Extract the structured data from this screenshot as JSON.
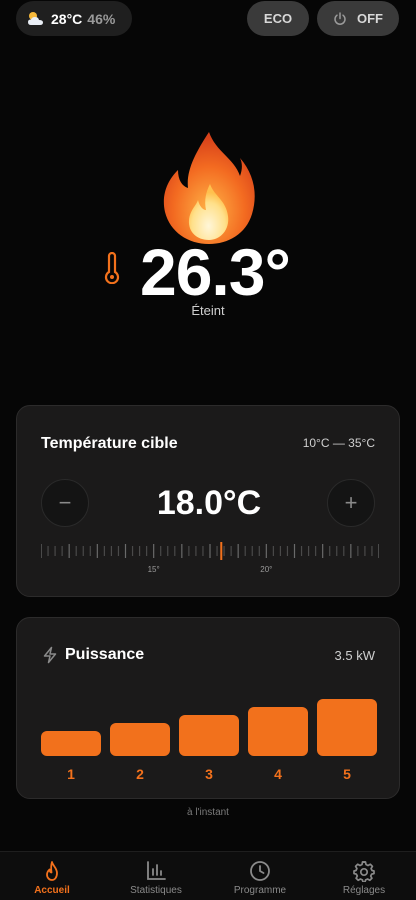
{
  "weather": {
    "temp": "28°C",
    "humidity": "46%",
    "icon": "partly-cloudy-icon"
  },
  "header": {
    "eco_label": "ECO",
    "power_label": "OFF"
  },
  "hero": {
    "current_temp": "26.3°",
    "status": "Éteint"
  },
  "target": {
    "title": "Température cible",
    "range": "10°C — 35°C",
    "value": "18.0°C",
    "minus": "−",
    "plus": "+",
    "scale_min": 10,
    "scale_max": 25,
    "scale_value": 18,
    "tick_labels": [
      "15°",
      "20°"
    ]
  },
  "power": {
    "title": "Puissance",
    "value": "3.5 kW",
    "levels": [
      {
        "label": "1",
        "level": 1
      },
      {
        "label": "2",
        "level": 2
      },
      {
        "label": "3",
        "level": 3
      },
      {
        "label": "4",
        "level": 4
      },
      {
        "label": "5",
        "level": 5
      }
    ]
  },
  "updated": "à l'instant",
  "nav": [
    {
      "label": "Accueil",
      "icon": "flame-icon",
      "active": true
    },
    {
      "label": "Statistiques",
      "icon": "bar-chart-icon",
      "active": false
    },
    {
      "label": "Programme",
      "icon": "clock-icon",
      "active": false
    },
    {
      "label": "Réglages",
      "icon": "gear-icon",
      "active": false
    }
  ],
  "colors": {
    "accent": "#f2711c",
    "card": "#1b1a1a",
    "background": "#060606"
  }
}
